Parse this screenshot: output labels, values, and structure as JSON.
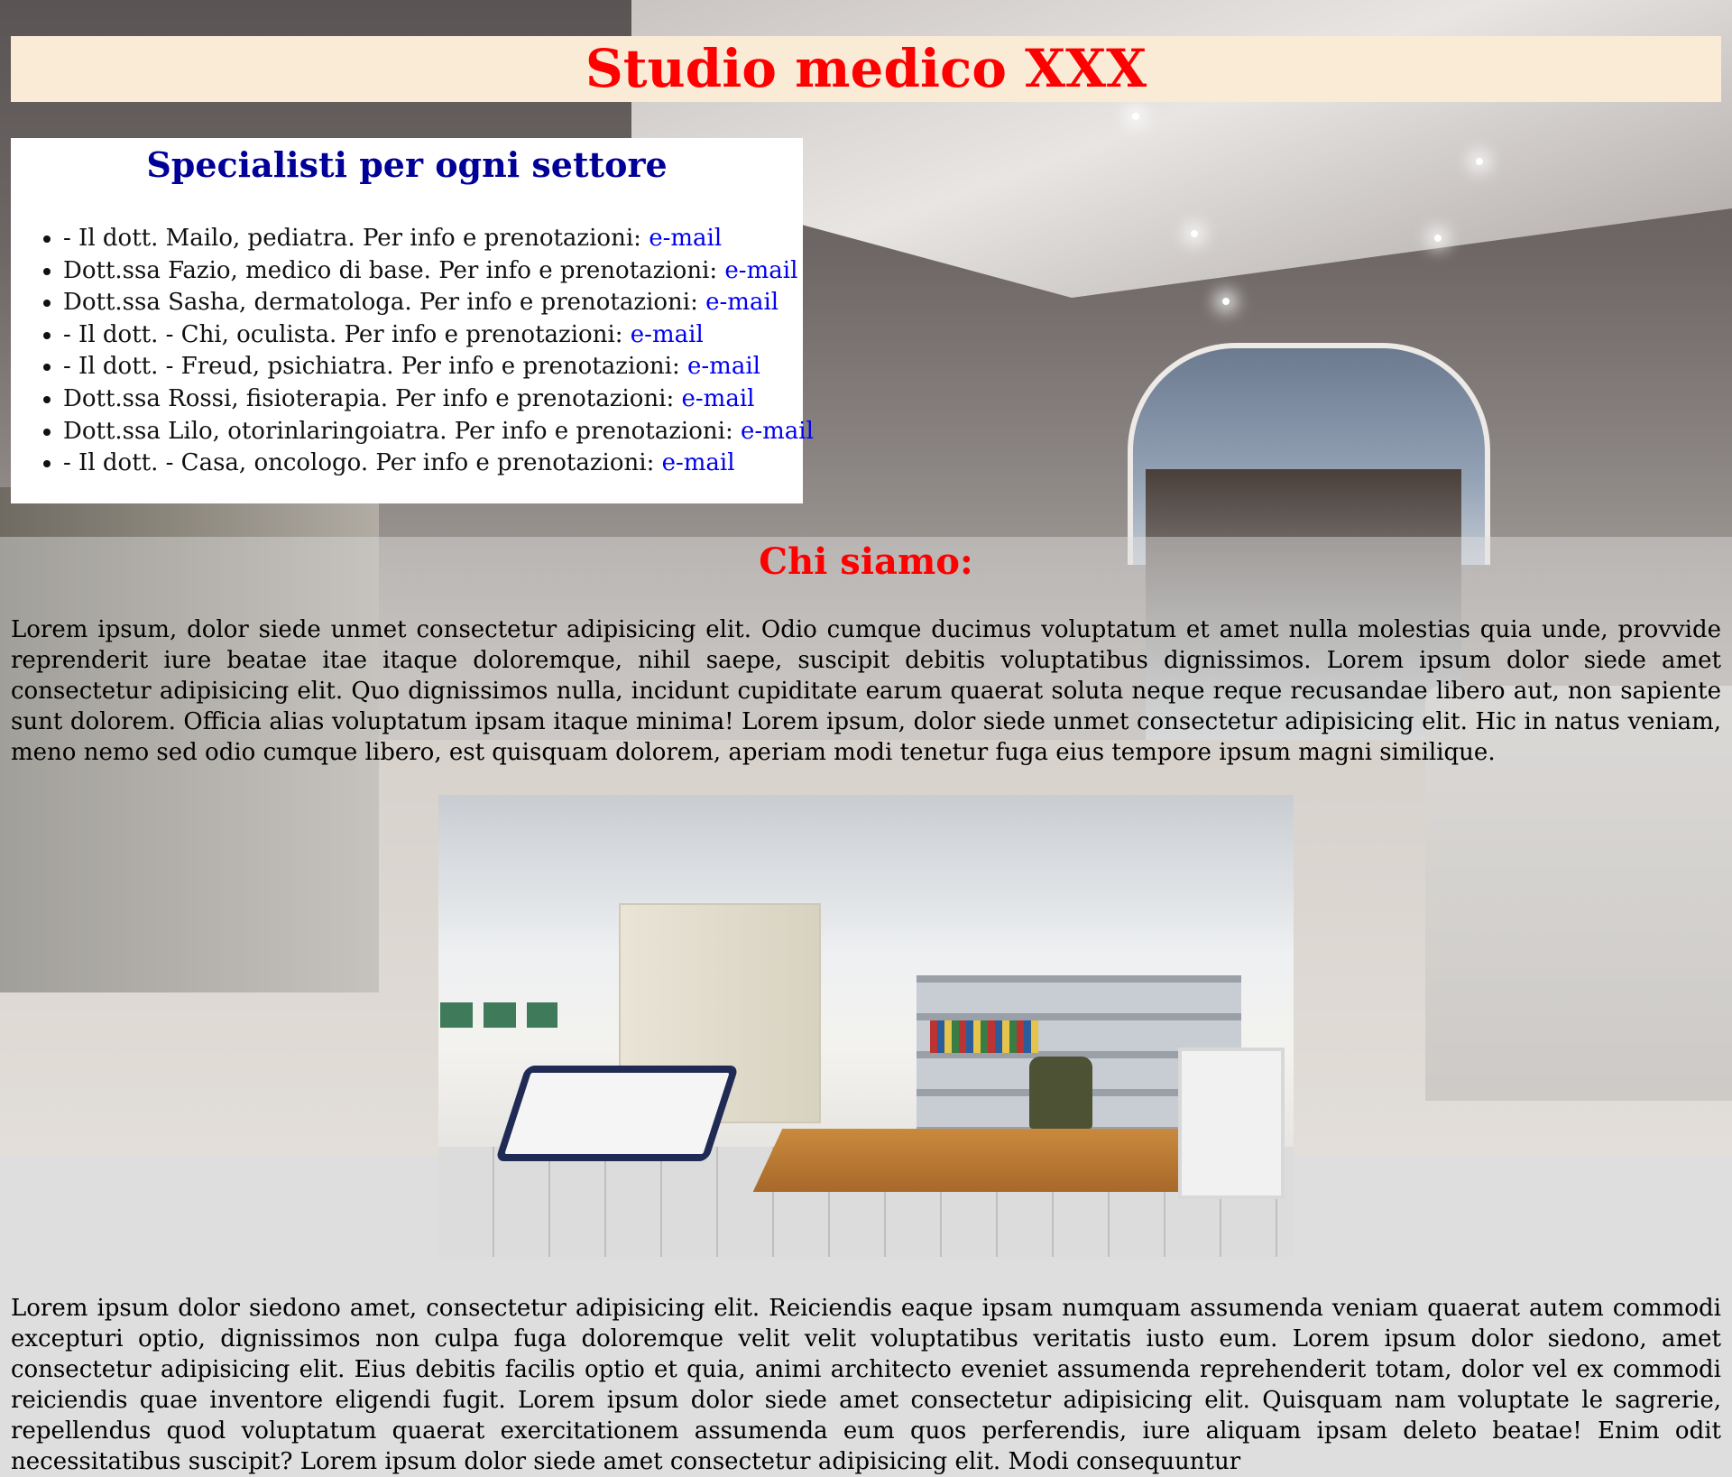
{
  "header": {
    "title": "Studio medico XXX"
  },
  "specialists": {
    "title": "Specialisti per ogni settore",
    "items": [
      {
        "text": "- Il dott. Mailo, pediatra. Per info e prenotazioni: ",
        "link": "e-mail"
      },
      {
        "text": "Dott.ssa Fazio, medico di base. Per info e prenotazioni: ",
        "link": "e-mail"
      },
      {
        "text": "Dott.ssa Sasha, dermatologa. Per info e prenotazioni: ",
        "link": "e-mail"
      },
      {
        "text": "- Il dott. - Chi, oculista. Per info e prenotazioni: ",
        "link": "e-mail"
      },
      {
        "text": "- Il dott. - Freud, psichiatra. Per info e prenotazioni: ",
        "link": "e-mail"
      },
      {
        "text": "Dott.ssa Rossi, fisioterapia. Per info e prenotazioni: ",
        "link": "e-mail"
      },
      {
        "text": "Dott.ssa Lilo, otorinlaringoiatra. Per info e prenotazioni: ",
        "link": "e-mail"
      },
      {
        "text": "- Il dott. - Casa, oncologo. Per info e prenotazioni: ",
        "link": "e-mail"
      }
    ]
  },
  "about": {
    "title": "Chi siamo:",
    "paragraph1": "Lorem ipsum, dolor siede unmet consectetur adipisicing elit. Odio cumque ducimus voluptatum et amet nulla molestias quia unde, provvide reprenderit iure beatae itae itaque doloremque, nihil saepe, suscipit debitis voluptatibus dignissimos. Lorem ipsum dolor siede amet consectetur adipisicing elit. Quo dignissimos nulla, incidunt cupiditate earum quaerat soluta neque reque recusandae libero aut, non sapiente sunt dolorem. Officia alias voluptatum ipsam itaque minima! Lorem ipsum, dolor siede unmet consectetur adipisicing elit. Hic in natus veniam, meno nemo sed odio cumque libero, est quisquam dolorem, aperiam modi tenetur fuga eius tempore ipsum magni similique.",
    "paragraph2": "Lorem ipsum dolor siedono amet, consectetur adipisicing elit. Reiciendis eaque ipsam numquam assumenda veniam quaerat autem commodi excepturi optio, dignissimos non culpa fuga doloremque velit velit voluptatibus veritatis iusto eum. Lorem ipsum dolor siedono, amet consectetur adipisicing elit. Eius debitis facilis optio et quia, animi architecto eveniet assumenda reprehenderit totam, dolor vel ex commodi reiciendis quae inventore eligendi fugit. Lorem ipsum dolor siede amet consectetur adipisicing elit. Quisquam nam voluptate le sagrerie, repellendus quod voluptatum quaerat exercitationem assumenda eum quos perferendis, iure aliquam ipsam deleto beatae! Enim odit necessitatibus suscipit? Lorem ipsum dolor siede amet consectetur adipisicing elit. Modi consequuntur"
  },
  "colors": {
    "header_bg": "#faebd7",
    "title_red": "#ff0000",
    "specialists_title": "#000099",
    "link_blue": "#0000ee",
    "page_bg": "#dedede"
  }
}
